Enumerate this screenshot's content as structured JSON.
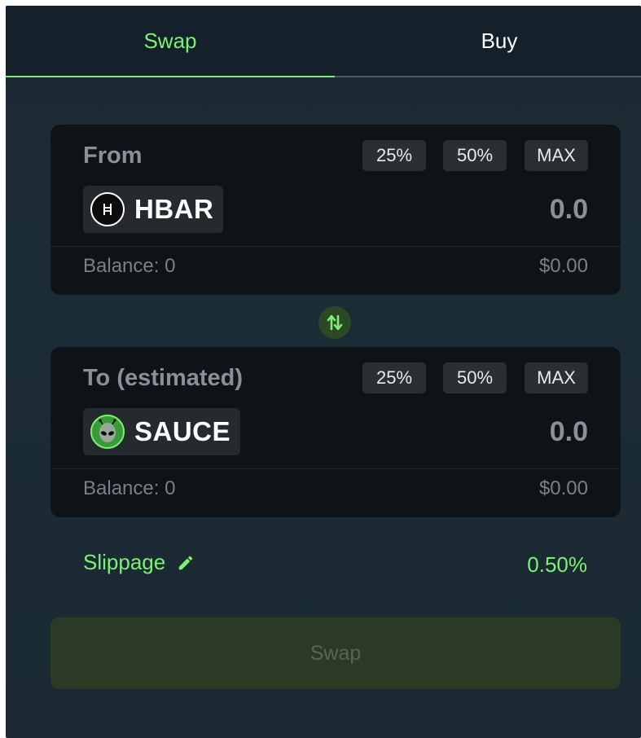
{
  "tabs": {
    "swap": "Swap",
    "buy": "Buy",
    "active": "Swap"
  },
  "from": {
    "title": "From",
    "pct_25": "25%",
    "pct_50": "50%",
    "pct_max": "MAX",
    "token": "HBAR",
    "token_icon": "hbar-icon",
    "amount": "0.0",
    "balance": "Balance: 0",
    "usd": "$0.00"
  },
  "to": {
    "title": "To (estimated)",
    "pct_25": "25%",
    "pct_50": "50%",
    "pct_max": "MAX",
    "token": "SAUCE",
    "token_icon": "sauce-alien-icon",
    "amount": "0.0",
    "balance": "Balance: 0",
    "usd": "$0.00"
  },
  "swap_direction_icon": "swap-arrows-icon",
  "slippage": {
    "label": "Slippage",
    "icon": "pencil-icon",
    "value": "0.50%"
  },
  "submit": {
    "label": "Swap",
    "disabled": true
  },
  "colors": {
    "accent": "#7ef073",
    "background": "#1b2a33",
    "card": "#0e1317",
    "disabled_button": "#2a3a25"
  }
}
